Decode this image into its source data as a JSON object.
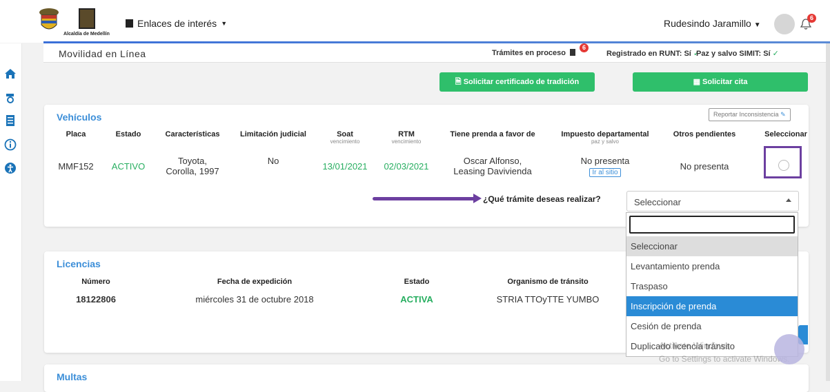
{
  "header": {
    "logo_text": "Alcaldía de Medellín",
    "links_label": "Enlaces de interés",
    "user_name": "Rudesindo Jaramillo",
    "notifications_count": "6"
  },
  "subbar": {
    "title": "Movilidad en Línea",
    "tramites_label": "Trámites en proceso",
    "tramites_count": "6",
    "runt_label": "Registrado en RUNT: Sí",
    "simit_label": "Paz y salvo SIMIT: Sí",
    "check": "✓"
  },
  "actions": {
    "certificado": "Solicitar certificado de tradición",
    "cita": "Solicitar cita"
  },
  "vehiculos": {
    "title": "Vehículos",
    "report_label": "Reportar Inconsistencia",
    "headers": {
      "placa": "Placa",
      "estado": "Estado",
      "caracteristicas": "Características",
      "limitacion": "Limitación judicial",
      "soat": "Soat",
      "soat_sub": "vencimiento",
      "rtm": "RTM",
      "rtm_sub": "vencimiento",
      "prenda": "Tiene prenda a favor de",
      "impuesto": "Impuesto departamental",
      "impuesto_sub": "paz y salvo",
      "otros": "Otros pendientes",
      "seleccionar": "Seleccionar"
    },
    "row": {
      "placa": "MMF152",
      "estado": "ACTIVO",
      "caracteristicas_1": "Toyota,",
      "caracteristicas_2": "Corolla, 1997",
      "limitacion": "No",
      "soat": "13/01/2021",
      "rtm": "02/03/2021",
      "prenda_1": "Oscar Alfonso,",
      "prenda_2": "Leasing Davivienda",
      "impuesto": "No presenta",
      "ir_sitio": "Ir al sitio",
      "otros": "No presenta"
    },
    "question": "¿Qué trámite deseas realizar?",
    "select_value": "Seleccionar",
    "options": [
      "Seleccionar",
      "Levantamiento prenda",
      "Traspaso",
      "Inscripción de prenda",
      "Cesión de prenda",
      "Duplicado licencia tránsito"
    ]
  },
  "licencias": {
    "title": "Licencias",
    "headers": {
      "numero": "Número",
      "fecha": "Fecha de expedición",
      "estado": "Estado",
      "organismo": "Organismo de tránsito"
    },
    "row": {
      "numero": "18122806",
      "fecha": "miércoles 31 de octubre 2018",
      "estado": "ACTIVA",
      "organismo": "STRIA TTOyTTE YUMBO"
    }
  },
  "multas": {
    "title": "Multas"
  },
  "watermark": {
    "line1": "Activate Windows",
    "line2": "Go to Settings to activate Windows."
  }
}
